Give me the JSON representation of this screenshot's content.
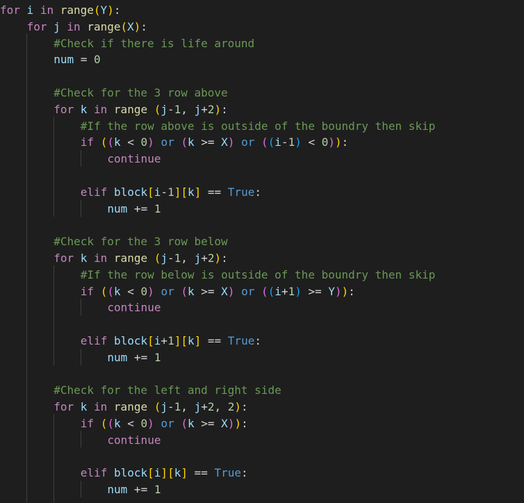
{
  "editor": {
    "theme_colors": {
      "background": "#1e1e1e",
      "keyword": "#c586c0",
      "constant": "#569cd6",
      "function": "#dcdcaa",
      "variable": "#9cdcfe",
      "number": "#b5cea8",
      "comment": "#6a9955",
      "bracket_level_1": "#ffd700",
      "bracket_level_2": "#da70d6",
      "bracket_level_3": "#179fff"
    },
    "lines": [
      {
        "indent": 0,
        "tokens": [
          {
            "t": "for",
            "c": "kw"
          },
          {
            "t": " "
          },
          {
            "t": "i",
            "c": "var"
          },
          {
            "t": " "
          },
          {
            "t": "in",
            "c": "kw"
          },
          {
            "t": " "
          },
          {
            "t": "range",
            "c": "fn"
          },
          {
            "t": "(",
            "c": "b1"
          },
          {
            "t": "Y",
            "c": "var"
          },
          {
            "t": ")",
            "c": "b1"
          },
          {
            "t": ":"
          }
        ]
      },
      {
        "indent": 1,
        "tokens": [
          {
            "t": "for",
            "c": "kw"
          },
          {
            "t": " "
          },
          {
            "t": "j",
            "c": "var"
          },
          {
            "t": " "
          },
          {
            "t": "in",
            "c": "kw"
          },
          {
            "t": " "
          },
          {
            "t": "range",
            "c": "fn"
          },
          {
            "t": "(",
            "c": "b1"
          },
          {
            "t": "X",
            "c": "var"
          },
          {
            "t": ")",
            "c": "b1"
          },
          {
            "t": ":"
          }
        ]
      },
      {
        "indent": 2,
        "tokens": [
          {
            "t": "#Check if there is life around",
            "c": "cm"
          }
        ]
      },
      {
        "indent": 2,
        "tokens": [
          {
            "t": "num",
            "c": "var"
          },
          {
            "t": " = ",
            "c": "op"
          },
          {
            "t": "0",
            "c": "num"
          }
        ]
      },
      {
        "indent": 0,
        "tokens": []
      },
      {
        "indent": 2,
        "tokens": [
          {
            "t": "#Check for the 3 row above",
            "c": "cm"
          }
        ]
      },
      {
        "indent": 2,
        "tokens": [
          {
            "t": "for",
            "c": "kw"
          },
          {
            "t": " "
          },
          {
            "t": "k",
            "c": "var"
          },
          {
            "t": " "
          },
          {
            "t": "in",
            "c": "kw"
          },
          {
            "t": " "
          },
          {
            "t": "range",
            "c": "fn"
          },
          {
            "t": " "
          },
          {
            "t": "(",
            "c": "b1"
          },
          {
            "t": "j",
            "c": "var"
          },
          {
            "t": "-",
            "c": "op"
          },
          {
            "t": "1",
            "c": "num"
          },
          {
            "t": ", "
          },
          {
            "t": "j",
            "c": "var"
          },
          {
            "t": "+",
            "c": "op"
          },
          {
            "t": "2",
            "c": "num"
          },
          {
            "t": ")",
            "c": "b1"
          },
          {
            "t": ":"
          }
        ]
      },
      {
        "indent": 3,
        "tokens": [
          {
            "t": "#If the row above is outside of the boundry then skip",
            "c": "cm"
          }
        ]
      },
      {
        "indent": 3,
        "tokens": [
          {
            "t": "if",
            "c": "kw"
          },
          {
            "t": " "
          },
          {
            "t": "(",
            "c": "b1"
          },
          {
            "t": "(",
            "c": "b2"
          },
          {
            "t": "k",
            "c": "var"
          },
          {
            "t": " < ",
            "c": "op"
          },
          {
            "t": "0",
            "c": "num"
          },
          {
            "t": ")",
            "c": "b2"
          },
          {
            "t": " "
          },
          {
            "t": "or",
            "c": "blue"
          },
          {
            "t": " "
          },
          {
            "t": "(",
            "c": "b2"
          },
          {
            "t": "k",
            "c": "var"
          },
          {
            "t": " >= ",
            "c": "op"
          },
          {
            "t": "X",
            "c": "var"
          },
          {
            "t": ")",
            "c": "b2"
          },
          {
            "t": " "
          },
          {
            "t": "or",
            "c": "blue"
          },
          {
            "t": " "
          },
          {
            "t": "(",
            "c": "b2"
          },
          {
            "t": "(",
            "c": "b3"
          },
          {
            "t": "i",
            "c": "var"
          },
          {
            "t": "-",
            "c": "op"
          },
          {
            "t": "1",
            "c": "num"
          },
          {
            "t": ")",
            "c": "b3"
          },
          {
            "t": " < ",
            "c": "op"
          },
          {
            "t": "0",
            "c": "num"
          },
          {
            "t": ")",
            "c": "b2"
          },
          {
            "t": ")",
            "c": "b1"
          },
          {
            "t": ":"
          }
        ]
      },
      {
        "indent": 4,
        "tokens": [
          {
            "t": "continue",
            "c": "kw"
          }
        ]
      },
      {
        "indent": 0,
        "tokens": []
      },
      {
        "indent": 3,
        "tokens": [
          {
            "t": "elif",
            "c": "kw"
          },
          {
            "t": " "
          },
          {
            "t": "block",
            "c": "var"
          },
          {
            "t": "[",
            "c": "b1"
          },
          {
            "t": "i",
            "c": "var"
          },
          {
            "t": "-",
            "c": "op"
          },
          {
            "t": "1",
            "c": "num"
          },
          {
            "t": "]",
            "c": "b1"
          },
          {
            "t": "[",
            "c": "b1"
          },
          {
            "t": "k",
            "c": "var"
          },
          {
            "t": "]",
            "c": "b1"
          },
          {
            "t": " == ",
            "c": "op"
          },
          {
            "t": "True",
            "c": "blue"
          },
          {
            "t": ":"
          }
        ]
      },
      {
        "indent": 4,
        "tokens": [
          {
            "t": "num",
            "c": "var"
          },
          {
            "t": " += ",
            "c": "op"
          },
          {
            "t": "1",
            "c": "num"
          }
        ]
      },
      {
        "indent": 0,
        "tokens": []
      },
      {
        "indent": 2,
        "tokens": [
          {
            "t": "#Check for the 3 row below",
            "c": "cm"
          }
        ]
      },
      {
        "indent": 2,
        "tokens": [
          {
            "t": "for",
            "c": "kw"
          },
          {
            "t": " "
          },
          {
            "t": "k",
            "c": "var"
          },
          {
            "t": " "
          },
          {
            "t": "in",
            "c": "kw"
          },
          {
            "t": " "
          },
          {
            "t": "range",
            "c": "fn"
          },
          {
            "t": " "
          },
          {
            "t": "(",
            "c": "b1"
          },
          {
            "t": "j",
            "c": "var"
          },
          {
            "t": "-",
            "c": "op"
          },
          {
            "t": "1",
            "c": "num"
          },
          {
            "t": ", "
          },
          {
            "t": "j",
            "c": "var"
          },
          {
            "t": "+",
            "c": "op"
          },
          {
            "t": "2",
            "c": "num"
          },
          {
            "t": ")",
            "c": "b1"
          },
          {
            "t": ":"
          }
        ]
      },
      {
        "indent": 3,
        "tokens": [
          {
            "t": "#If the row below is outside of the boundry then skip",
            "c": "cm"
          }
        ]
      },
      {
        "indent": 3,
        "tokens": [
          {
            "t": "if",
            "c": "kw"
          },
          {
            "t": " "
          },
          {
            "t": "(",
            "c": "b1"
          },
          {
            "t": "(",
            "c": "b2"
          },
          {
            "t": "k",
            "c": "var"
          },
          {
            "t": " < ",
            "c": "op"
          },
          {
            "t": "0",
            "c": "num"
          },
          {
            "t": ")",
            "c": "b2"
          },
          {
            "t": " "
          },
          {
            "t": "or",
            "c": "blue"
          },
          {
            "t": " "
          },
          {
            "t": "(",
            "c": "b2"
          },
          {
            "t": "k",
            "c": "var"
          },
          {
            "t": " >= ",
            "c": "op"
          },
          {
            "t": "X",
            "c": "var"
          },
          {
            "t": ")",
            "c": "b2"
          },
          {
            "t": " "
          },
          {
            "t": "or",
            "c": "blue"
          },
          {
            "t": " "
          },
          {
            "t": "(",
            "c": "b2"
          },
          {
            "t": "(",
            "c": "b3"
          },
          {
            "t": "i",
            "c": "var"
          },
          {
            "t": "+",
            "c": "op"
          },
          {
            "t": "1",
            "c": "num"
          },
          {
            "t": ")",
            "c": "b3"
          },
          {
            "t": " >= ",
            "c": "op"
          },
          {
            "t": "Y",
            "c": "var"
          },
          {
            "t": ")",
            "c": "b2"
          },
          {
            "t": ")",
            "c": "b1"
          },
          {
            "t": ":"
          }
        ]
      },
      {
        "indent": 4,
        "tokens": [
          {
            "t": "continue",
            "c": "kw"
          }
        ]
      },
      {
        "indent": 0,
        "tokens": []
      },
      {
        "indent": 3,
        "tokens": [
          {
            "t": "elif",
            "c": "kw"
          },
          {
            "t": " "
          },
          {
            "t": "block",
            "c": "var"
          },
          {
            "t": "[",
            "c": "b1"
          },
          {
            "t": "i",
            "c": "var"
          },
          {
            "t": "+",
            "c": "op"
          },
          {
            "t": "1",
            "c": "num"
          },
          {
            "t": "]",
            "c": "b1"
          },
          {
            "t": "[",
            "c": "b1"
          },
          {
            "t": "k",
            "c": "var"
          },
          {
            "t": "]",
            "c": "b1"
          },
          {
            "t": " == ",
            "c": "op"
          },
          {
            "t": "True",
            "c": "blue"
          },
          {
            "t": ":"
          }
        ]
      },
      {
        "indent": 4,
        "tokens": [
          {
            "t": "num",
            "c": "var"
          },
          {
            "t": " += ",
            "c": "op"
          },
          {
            "t": "1",
            "c": "num"
          }
        ]
      },
      {
        "indent": 0,
        "tokens": []
      },
      {
        "indent": 2,
        "tokens": [
          {
            "t": "#Check for the left and right side",
            "c": "cm"
          }
        ]
      },
      {
        "indent": 2,
        "tokens": [
          {
            "t": "for",
            "c": "kw"
          },
          {
            "t": " "
          },
          {
            "t": "k",
            "c": "var"
          },
          {
            "t": " "
          },
          {
            "t": "in",
            "c": "kw"
          },
          {
            "t": " "
          },
          {
            "t": "range",
            "c": "fn"
          },
          {
            "t": " "
          },
          {
            "t": "(",
            "c": "b1"
          },
          {
            "t": "j",
            "c": "var"
          },
          {
            "t": "-",
            "c": "op"
          },
          {
            "t": "1",
            "c": "num"
          },
          {
            "t": ", "
          },
          {
            "t": "j",
            "c": "var"
          },
          {
            "t": "+",
            "c": "op"
          },
          {
            "t": "2",
            "c": "num"
          },
          {
            "t": ", "
          },
          {
            "t": "2",
            "c": "num"
          },
          {
            "t": ")",
            "c": "b1"
          },
          {
            "t": ":"
          }
        ]
      },
      {
        "indent": 3,
        "tokens": [
          {
            "t": "if",
            "c": "kw"
          },
          {
            "t": " "
          },
          {
            "t": "(",
            "c": "b1"
          },
          {
            "t": "(",
            "c": "b2"
          },
          {
            "t": "k",
            "c": "var"
          },
          {
            "t": " < ",
            "c": "op"
          },
          {
            "t": "0",
            "c": "num"
          },
          {
            "t": ")",
            "c": "b2"
          },
          {
            "t": " "
          },
          {
            "t": "or",
            "c": "blue"
          },
          {
            "t": " "
          },
          {
            "t": "(",
            "c": "b2"
          },
          {
            "t": "k",
            "c": "var"
          },
          {
            "t": " >= ",
            "c": "op"
          },
          {
            "t": "X",
            "c": "var"
          },
          {
            "t": ")",
            "c": "b2"
          },
          {
            "t": ")",
            "c": "b1"
          },
          {
            "t": ":"
          }
        ]
      },
      {
        "indent": 4,
        "tokens": [
          {
            "t": "continue",
            "c": "kw"
          }
        ]
      },
      {
        "indent": 0,
        "tokens": []
      },
      {
        "indent": 3,
        "tokens": [
          {
            "t": "elif",
            "c": "kw"
          },
          {
            "t": " "
          },
          {
            "t": "block",
            "c": "var"
          },
          {
            "t": "[",
            "c": "b1"
          },
          {
            "t": "i",
            "c": "var"
          },
          {
            "t": "]",
            "c": "b1"
          },
          {
            "t": "[",
            "c": "b1"
          },
          {
            "t": "k",
            "c": "var"
          },
          {
            "t": "]",
            "c": "b1"
          },
          {
            "t": " == ",
            "c": "op"
          },
          {
            "t": "True",
            "c": "blue"
          },
          {
            "t": ":"
          }
        ]
      },
      {
        "indent": 4,
        "tokens": [
          {
            "t": "num",
            "c": "var"
          },
          {
            "t": " += ",
            "c": "op"
          },
          {
            "t": "1",
            "c": "num"
          }
        ]
      }
    ]
  }
}
